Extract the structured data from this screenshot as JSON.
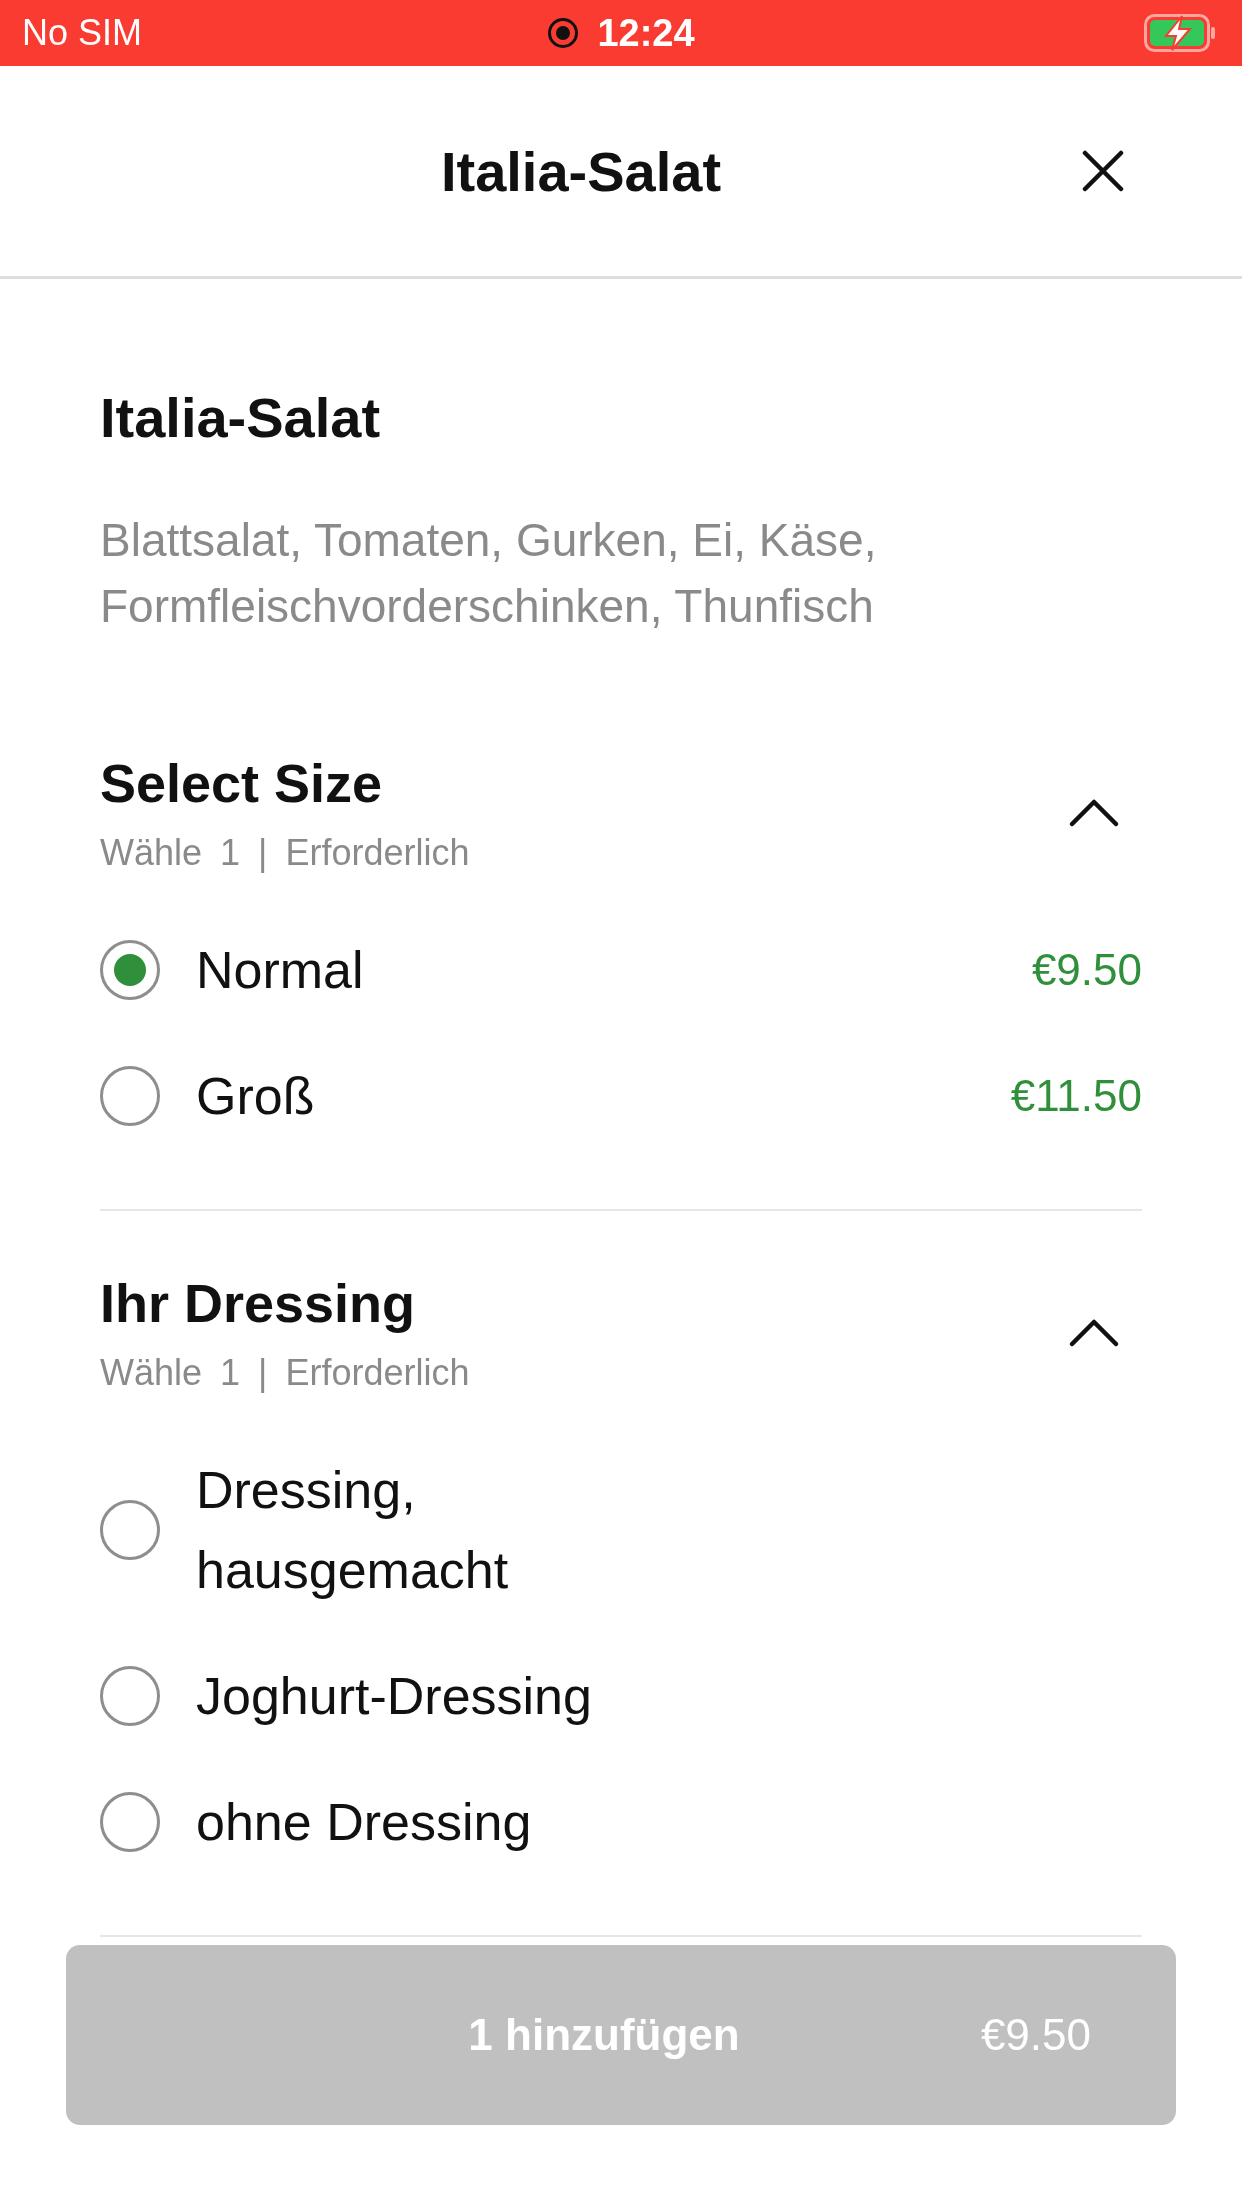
{
  "status_bar": {
    "carrier": "No SIM",
    "time": "12:24"
  },
  "header": {
    "title": "Italia-Salat"
  },
  "item": {
    "name": "Italia-Salat",
    "description": "Blattsalat, Tomaten, Gurken, Ei, Käse, Formfleischvorderschinken, Thunfisch"
  },
  "sections": [
    {
      "title": "Select Size",
      "subtitle": "Wähle 1 | Erforderlich",
      "expanded": true,
      "options": [
        {
          "label": "Normal",
          "price": "€9.50",
          "selected": true
        },
        {
          "label": "Groß",
          "price": "€11.50",
          "selected": false
        }
      ]
    },
    {
      "title": "Ihr Dressing",
      "subtitle": "Wähle 1 | Erforderlich",
      "expanded": true,
      "options": [
        {
          "label": "Dressing, hausgemacht",
          "selected": false
        },
        {
          "label": "Joghurt-Dressing",
          "selected": false
        },
        {
          "label": "ohne Dressing",
          "selected": false
        }
      ]
    }
  ],
  "add_button": {
    "label": "1 hinzufügen",
    "price": "€9.50",
    "disabled": true
  }
}
